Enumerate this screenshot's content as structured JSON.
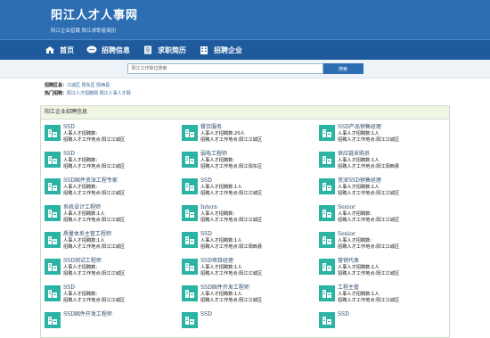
{
  "site": {
    "title": "阳江人才人事网",
    "subtitle": "阳江企业招聘 阳江求职者简历"
  },
  "nav": [
    {
      "label": "首页",
      "icon": "home-icon"
    },
    {
      "label": "招聘信息",
      "icon": "chat-icon"
    },
    {
      "label": "求职简历",
      "icon": "document-icon"
    },
    {
      "label": "招聘企业",
      "icon": "building-icon"
    }
  ],
  "search": {
    "placeholder": "阳江工作职位搜索",
    "button": "搜索"
  },
  "regions": {
    "label": "招聘区县：",
    "value": "江城区 阳东区 阳西县"
  },
  "hot": {
    "label": "热门招聘：",
    "value": "阳江人才招聘网 阳江人事人才网"
  },
  "panel": {
    "title": "阳江企业招聘信息"
  },
  "jobs": [
    {
      "title": "SSD",
      "count": "人事人才招聘数:",
      "place": "招聘人才工作地点:阳江江城区"
    },
    {
      "title": "餐饮服务",
      "count": "人事人才招聘数:20人",
      "place": "招聘人才工作地点:阳江江城区"
    },
    {
      "title": "SSD产品销售经理",
      "count": "人事人才招聘数:1人",
      "place": "招聘人才工作地点:阳江江城区"
    },
    {
      "title": "SSD",
      "count": "人事人才招聘数:",
      "place": "招聘人才工作地点:阳江江城区"
    },
    {
      "title": "弱电工程师",
      "count": "人事人才招聘数:",
      "place": "招聘人才工作地点:阳江阳东区"
    },
    {
      "title": "供应链采购员",
      "count": "人事人才招聘数:1人",
      "place": "招聘人才工作地点:阳江阳西县"
    },
    {
      "title": "SSD固件资深工程专家",
      "count": "人事人才招聘数:",
      "place": "招聘人才工作地点:阳江江城区"
    },
    {
      "title": "SSD",
      "count": "人事人才招聘数:1人",
      "place": "招聘人才工作地点:阳江江城区"
    },
    {
      "title": "资深SSD销售经理",
      "count": "人事人才招聘数:1人",
      "place": "招聘人才工作地点:阳江江城区"
    },
    {
      "title": "系统设计工程师",
      "count": "人事人才招聘数:1人",
      "place": "招聘人才工作地点:阳江江城区"
    },
    {
      "title": "Intern",
      "count": "人事人才招聘数:",
      "place": "招聘人才工作地点:阳江江城区"
    },
    {
      "title": "Senior",
      "count": "人事人才招聘数:",
      "place": "招聘人才工作地点:阳江江城区"
    },
    {
      "title": "质量体系主管工程师",
      "count": "人事人才招聘数:1人",
      "place": "招聘人才工作地点:阳江江城区"
    },
    {
      "title": "SSD",
      "count": "人事人才招聘数:1人",
      "place": "招聘人才工作地点:阳江阳西县"
    },
    {
      "title": "Senior",
      "count": "人事人才招聘数:",
      "place": "招聘人才工作地点:阳江江城区"
    },
    {
      "title": "SSD测试工程师",
      "count": "人事人才招聘数:",
      "place": "招聘人才工作地点:阳江江城区"
    },
    {
      "title": "SSD项目经理",
      "count": "人事人才招聘数:1人",
      "place": "招聘人才工作地点:阳江江城区"
    },
    {
      "title": "营销代表",
      "count": "人事人才招聘数:1人",
      "place": "招聘人才工作地点:阳江江城区"
    },
    {
      "title": "SSD",
      "count": "人事人才招聘数:",
      "place": "招聘人才工作地点:阳江江城区"
    },
    {
      "title": "SSD固件开发工程师",
      "count": "人事人才招聘数:1人",
      "place": "招聘人才工作地点:阳江江城区"
    },
    {
      "title": "工程主管",
      "count": "人事人才招聘数:1人",
      "place": "招聘人才工作地点:阳江江城区"
    },
    {
      "title": "SSD固件开发工程师",
      "count": "",
      "place": ""
    },
    {
      "title": "SSD",
      "count": "",
      "place": ""
    },
    {
      "title": "SSD",
      "count": "",
      "place": ""
    }
  ],
  "colors": {
    "header": "#2d6eb3",
    "nav": "#1e5a9c",
    "thumb": "#2bb3a4"
  }
}
